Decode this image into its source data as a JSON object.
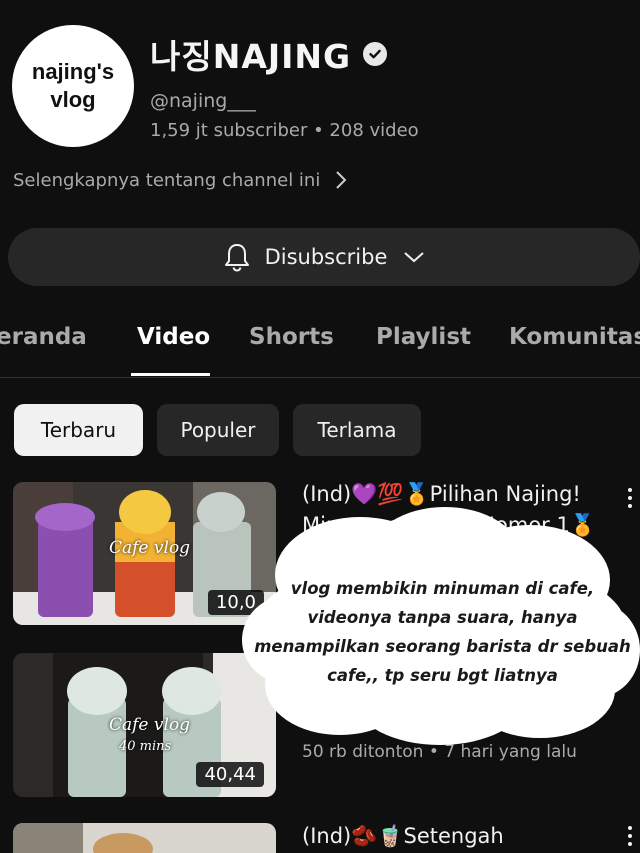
{
  "channel": {
    "avatar_line1": "najing's",
    "avatar_line2": "vlog",
    "name": "나징NAJING",
    "handle": "@najing___",
    "stats": "1,59 jt subscriber • 208 video",
    "more_link": "Selengkapnya tentang channel ini"
  },
  "subscribe": {
    "label": "Disubscribe"
  },
  "tabs": [
    "eranda",
    "Video",
    "Shorts",
    "Playlist",
    "Komunitas"
  ],
  "active_tab": "Video",
  "filters": [
    "Terbaru",
    "Populer",
    "Terlama"
  ],
  "active_filter": "Terbaru",
  "videos": [
    {
      "title_line1": "(Ind)💜💯🏅Pilihan Najing!",
      "title_line2": "Minuman .......... Nomor 1🏅",
      "duration": "10,0",
      "caption": "Cafe vlog"
    },
    {
      "meta": "50 rb ditonton • 7 hari yang lalu",
      "duration": "40,44",
      "caption": "Cafe vlog",
      "caption_sub": "40 mins"
    },
    {
      "title_line1": "(Ind)🫘🧋Setengah"
    }
  ],
  "overlay_note": "vlog membikin minuman di cafe, videonya tanpa suara, hanya menampilkan seorang barista dr sebuah cafe,, tp seru bgt liatnya",
  "colors": {
    "background": "#0f0f0f",
    "button_bg": "#272727",
    "text_primary": "#f1f1f1",
    "text_secondary": "#aaaaaa",
    "chip_active_bg": "#f1f1f1"
  },
  "icons": [
    "verified-icon",
    "chevron-right-icon",
    "bell-icon",
    "chevron-down-icon",
    "more-vert-icon"
  ]
}
